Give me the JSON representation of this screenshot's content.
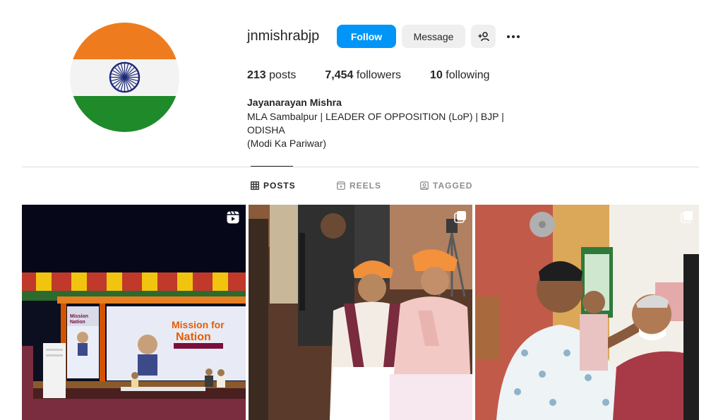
{
  "profile": {
    "username": "jnmishrabjp",
    "full_name": "Jayanarayan Mishra",
    "bio_line1": "MLA Sambalpur | LEADER OF OPPOSITION (LoP) | BJP | ODISHA",
    "bio_line2": "(Modi Ka Pariwar)",
    "avatar_colors": {
      "saffron": "#ee7c1f",
      "white": "#f3f3f3",
      "green": "#1f8a2a",
      "chakra": "#1d2a7a"
    }
  },
  "actions": {
    "follow_label": "Follow",
    "message_label": "Message",
    "add_user_icon": "add-user-icon",
    "more_icon": "more-options-icon",
    "accent": "#0095f6"
  },
  "stats": {
    "posts_count": "213",
    "posts_label": "posts",
    "followers_count": "7,454",
    "followers_label": "followers",
    "following_count": "10",
    "following_label": "following"
  },
  "tabs": [
    {
      "label": "POSTS",
      "icon": "grid-icon",
      "active": true
    },
    {
      "label": "REELS",
      "icon": "reels-icon",
      "active": false
    },
    {
      "label": "TAGGED",
      "icon": "tagged-icon",
      "active": false
    }
  ],
  "posts": [
    {
      "type": "reel",
      "badge_icon": "reel-icon",
      "banner_title": "Mission for Nation",
      "banner_side": "Mission for Nation"
    },
    {
      "type": "carousel",
      "badge_icon": "carousel-icon"
    },
    {
      "type": "carousel",
      "badge_icon": "carousel-icon"
    }
  ]
}
